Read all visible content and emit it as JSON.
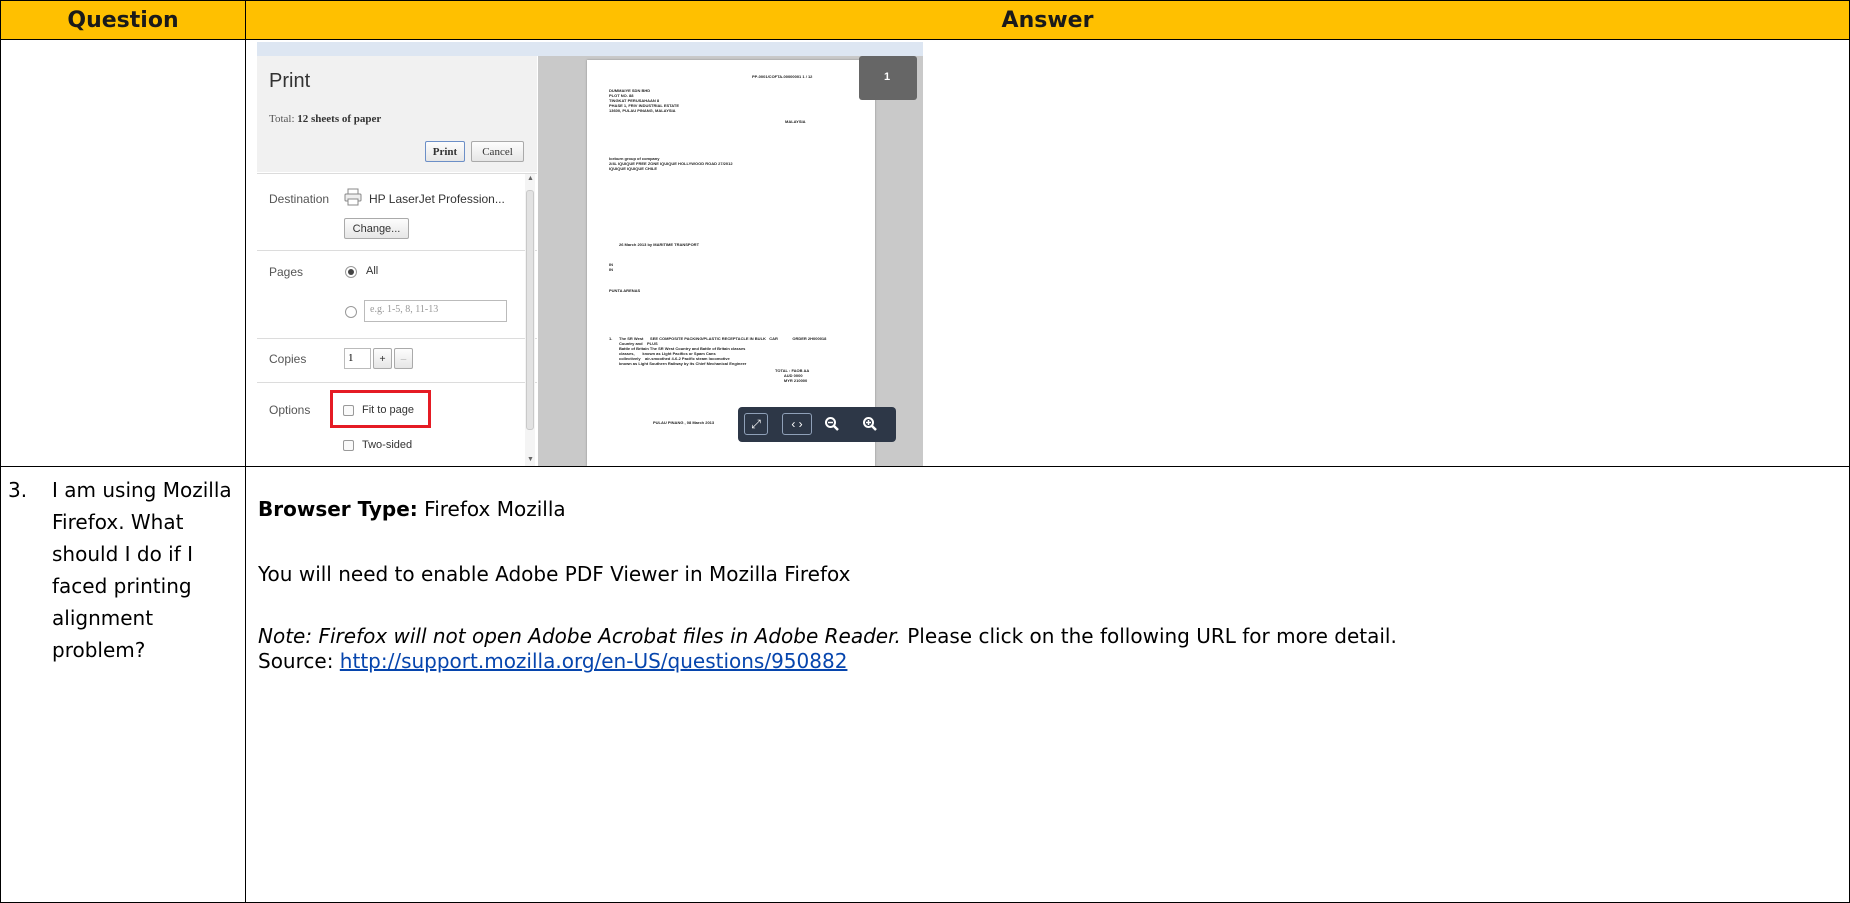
{
  "table": {
    "header_question": "Question",
    "header_answer": "Answer"
  },
  "colors": {
    "header_bg": "#ffc000",
    "highlight": "#e51b24",
    "link": "#0645ad"
  },
  "print_dialog": {
    "title": "Print",
    "total_label": "Total:",
    "total_value": "12 sheets of paper",
    "print_button": "Print",
    "cancel_button": "Cancel",
    "destination_label": "Destination",
    "destination_value": "HP LaserJet Profession...",
    "change_button": "Change...",
    "pages_label": "Pages",
    "pages_all": "All",
    "pages_placeholder": "e.g. 1-5, 8, 11-13",
    "copies_label": "Copies",
    "copies_value": "1",
    "plus": "+",
    "minus": "–",
    "options_label": "Options",
    "fit_to_page": "Fit to page",
    "two_sided": "Two-sided",
    "page_badge": "1",
    "zoom_icons": [
      "fit-page-icon",
      "fit-width-icon",
      "zoom-out-icon",
      "zoom-in-icon"
    ]
  },
  "row2": {
    "number": "3.",
    "question": "I am using Mozilla Firefox. What should I do if I faced printing alignment problem?",
    "browser_type_label": "Browser Type:",
    "browser_type_value": " Firefox Mozilla",
    "enable_text": "You will need to enable Adobe PDF Viewer in Mozilla Firefox",
    "note_italic": "Note: Firefox will not open Adobe Acrobat files in Adobe Reader.",
    "note_rest": " Please click on the following URL for more detail.",
    "source_label": "Source: ",
    "source_url": "http://support.mozilla.org/en-US/questions/950882"
  }
}
